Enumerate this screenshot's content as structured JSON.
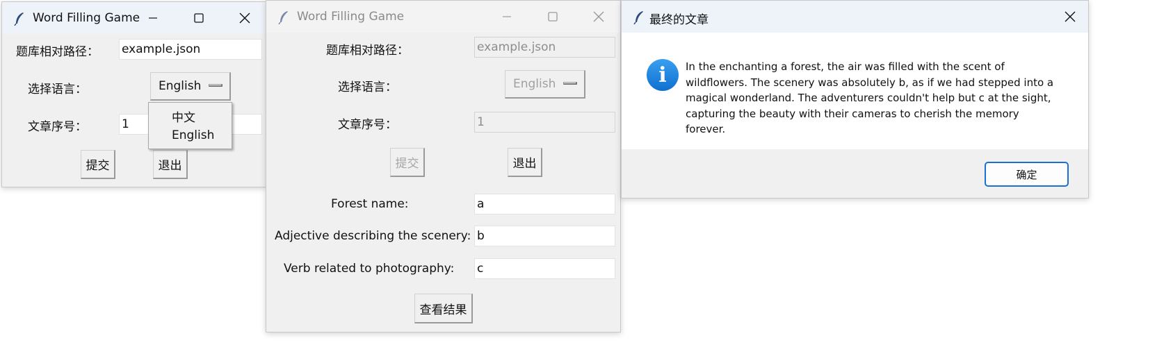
{
  "win1": {
    "title": "Word Filling Game",
    "path_label": "题库相对路径：",
    "path_value": "example.json",
    "lang_label": "选择语言：",
    "lang_selected": "English",
    "index_label": "文章序号：",
    "index_value": "1",
    "submit_label": "提交",
    "exit_label": "退出",
    "dropdown_options": [
      "中文",
      "English"
    ]
  },
  "win2": {
    "title": "Word Filling Game",
    "path_label": "题库相对路径：",
    "path_value": "example.json",
    "lang_label": "选择语言：",
    "lang_selected": "English",
    "index_label": "文章序号：",
    "index_value": "1",
    "submit_label": "提交",
    "exit_label": "退出",
    "fields": [
      {
        "label": "Forest name:",
        "value": "a"
      },
      {
        "label": "Adjective describing the scenery:",
        "value": "b"
      },
      {
        "label": "Verb related to photography:",
        "value": "c"
      }
    ],
    "result_label": "查看结果"
  },
  "win3": {
    "title": "最终的文章",
    "icon_glyph": "i",
    "message": "In the enchanting a forest, the air was filled with the scent of wildflowers. The scenery was absolutely b, as if we had stepped into a magical wonderland. The adventurers couldn't help but c at the sight, capturing the beauty with their cameras to cherish the memory forever.",
    "ok_label": "确定"
  },
  "icons": [
    "feather-icon",
    "minimize-icon",
    "maximize-icon",
    "close-icon",
    "info-icon"
  ],
  "colors": {
    "accent": "#1a6fd4",
    "info": "#1a7ee0",
    "window_bg": "#f0f0f0"
  }
}
